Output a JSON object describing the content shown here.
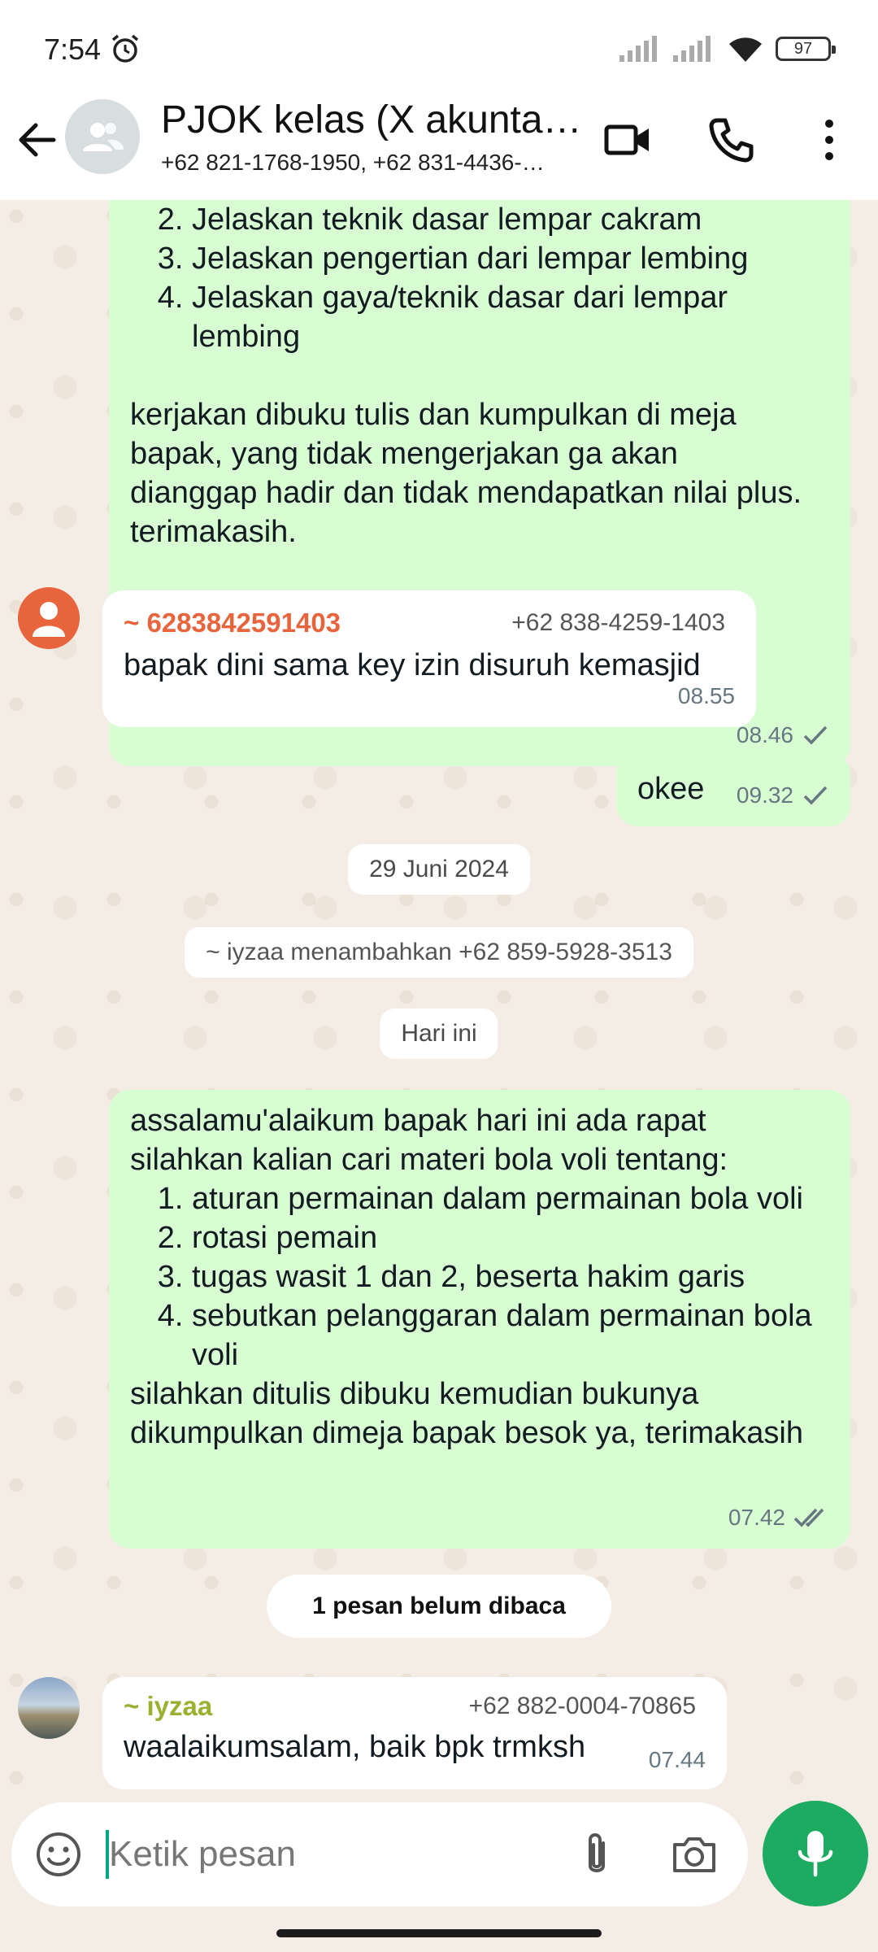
{
  "status_bar": {
    "time": "7:54",
    "battery": "97"
  },
  "header": {
    "title": "PJOK kelas (X akuntansi)",
    "subtitle": "+62 821-1768-1950, +62 831-4436-…"
  },
  "messages": [
    {
      "list_start": 2,
      "items": [
        "Jelaskan teknik dasar lempar cakram",
        "Jelaskan pengertian dari lempar lembing",
        "Jelaskan gaya/teknik dasar dari lempar lembing"
      ],
      "text": "kerjakan dibuku tulis dan kumpulkan di meja bapak, yang tidak mengerjakan ga akan dianggap hadir dan tidak mendapatkan nilai plus. terimakasih.",
      "time": "08.46"
    },
    {
      "sender": "~ 6283842591403",
      "phone": "+62 838-4259-1403",
      "text": "bapak dini sama key izin disuruh kemasjid",
      "time": "08.55"
    },
    {
      "text": "okee",
      "time": "09.32"
    },
    {
      "intro": "assalamu'alaikum bapak hari ini ada rapat silahkan kalian cari materi bola voli tentang:",
      "items": [
        "aturan permainan dalam permainan bola voli",
        "rotasi pemain",
        "tugas wasit 1 dan 2, beserta hakim garis",
        "sebutkan pelanggaran dalam permainan bola voli"
      ],
      "outro": "silahkan ditulis dibuku kemudian bukunya dikumpulkan dimeja bapak besok ya, terimakasih",
      "time": "07.42"
    },
    {
      "sender": "~ iyzaa",
      "phone": "+62 882-0004-70865",
      "text": "waalaikumsalam, baik bpk trmksh",
      "time": "07.44"
    }
  ],
  "system": {
    "date_chip": "29 Juni 2024",
    "added_notice": "~ iyzaa menambahkan +62 859-5928-3513",
    "today_chip": "Hari ini",
    "unread": "1 pesan belum dibaca"
  },
  "composer": {
    "placeholder": "Ketik pesan"
  },
  "colors": {
    "outgoing_bubble": "#d9fdd3",
    "incoming_bubble": "#ffffff",
    "sender1": "#e8643c",
    "sender2": "#9ab031",
    "accent": "#1daa61"
  }
}
